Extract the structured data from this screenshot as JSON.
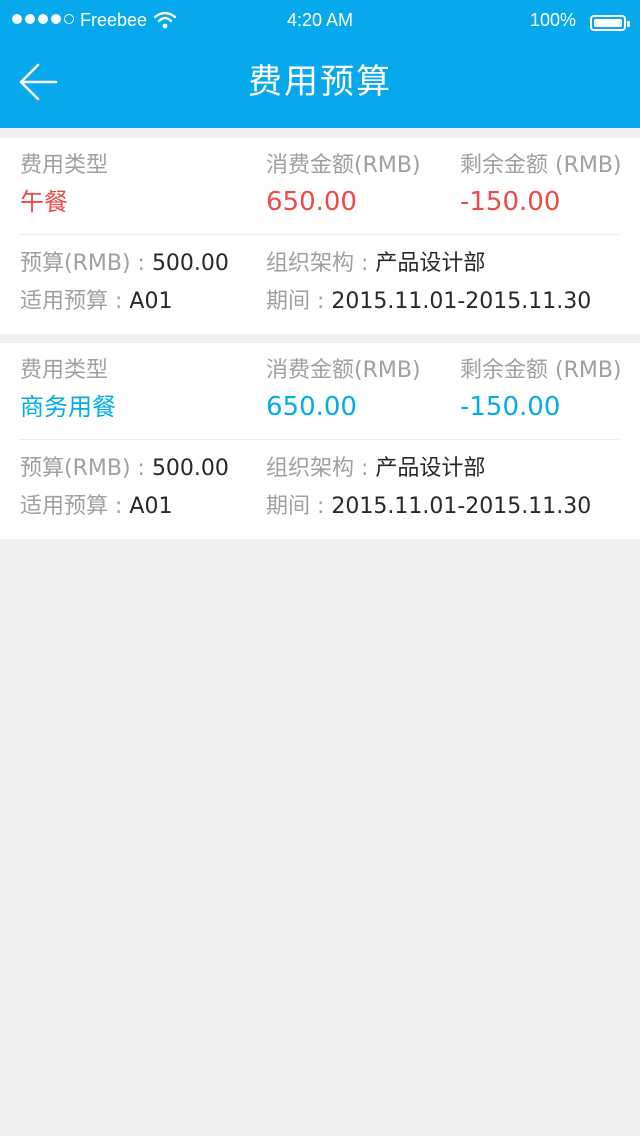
{
  "status_bar": {
    "carrier": "Freebee",
    "time": "4:20 AM",
    "battery": "100%"
  },
  "header": {
    "title": "费用预算"
  },
  "labels": {
    "type": "费用类型",
    "spent": "消费金额(RMB)",
    "remaining": "剩余金额 (RMB)",
    "budget_label": "预算(RMB) : ",
    "dept_label": "组织架构 : ",
    "apply_label": "适用预算 : ",
    "period_label": "期间 : "
  },
  "records": [
    {
      "type": "午餐",
      "spent": "650.00",
      "remaining": "-150.00",
      "budget": "500.00",
      "dept": "产品设计部",
      "apply": "A01",
      "period": "2015.11.01-2015.11.30",
      "accent": "#EF4949"
    },
    {
      "type": "商务用餐",
      "spent": "650.00",
      "remaining": "-150.00",
      "budget": "500.00",
      "dept": "产品设计部",
      "apply": "A01",
      "period": "2015.11.01-2015.11.30",
      "accent": "#00ADEF"
    }
  ],
  "colors": {
    "header_bg": "#08A8EC",
    "label_gray": "#A0A0A0",
    "value_dark": "#282828",
    "page_bg": "#EFEFEF"
  },
  "icons": {
    "back": "back-arrow-icon",
    "wifi": "wifi-icon",
    "battery": "battery-icon",
    "signal": "signal-dots-icon"
  }
}
